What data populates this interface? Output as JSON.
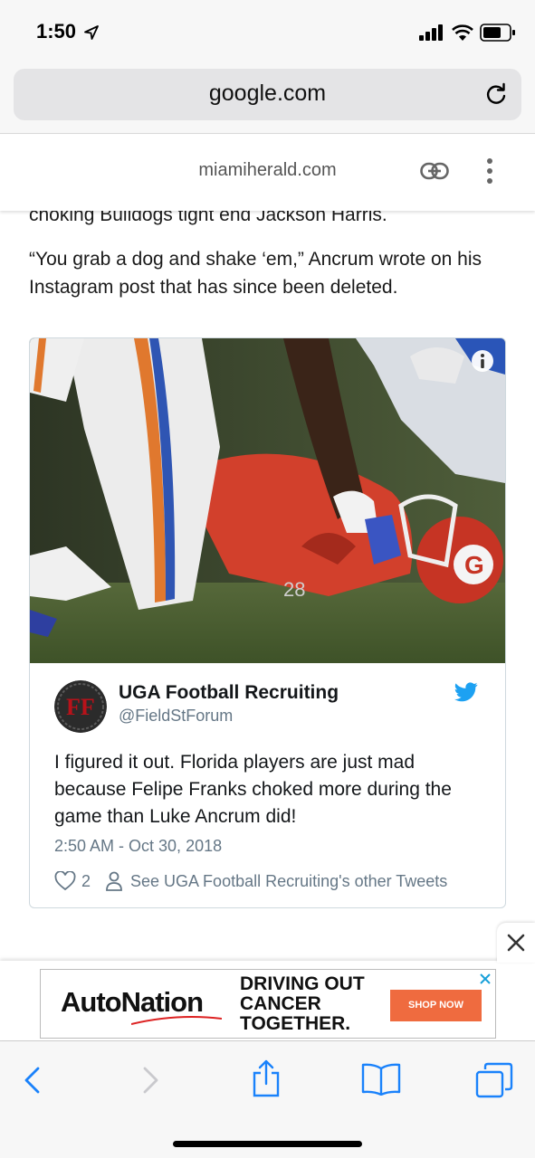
{
  "status_bar": {
    "time": "1:50"
  },
  "browser": {
    "url": "google.com"
  },
  "amp_header": {
    "domain": "miamiherald.com"
  },
  "article": {
    "paragraph_1": "choking Bulldogs tight end Jackson Harris.",
    "paragraph_2": "“You grab a dog and shake ‘em,” Ancrum wrote on his Instagram post that has since been deleted."
  },
  "tweet": {
    "author": "UGA Football Recruiting",
    "handle": "@FieldStForum",
    "text": "I figured it out. Florida players are just mad because Felipe Franks choked more during the game than Luke Ancrum did!",
    "timestamp": "2:50 AM - Oct 30, 2018",
    "likes": "2",
    "other_tweets_link": "See UGA Football Recruiting's other Tweets"
  },
  "ad": {
    "brand": "AutoNation",
    "tagline": "DRIVING OUT CANCER TOGETHER.",
    "cta": "SHOP NOW"
  },
  "colors": {
    "twitter_blue": "#1da1f2",
    "safari_blue": "#1a82fb",
    "ad_orange": "#ef6b3f"
  },
  "icons": [
    "location-arrow-icon",
    "signal-icon",
    "wifi-icon",
    "battery-icon",
    "reload-icon",
    "link-icon",
    "more-vertical-icon",
    "info-icon",
    "twitter-bird-icon",
    "heart-icon",
    "person-icon",
    "close-icon",
    "back-icon",
    "forward-icon",
    "share-icon",
    "bookmarks-icon",
    "tabs-icon"
  ]
}
